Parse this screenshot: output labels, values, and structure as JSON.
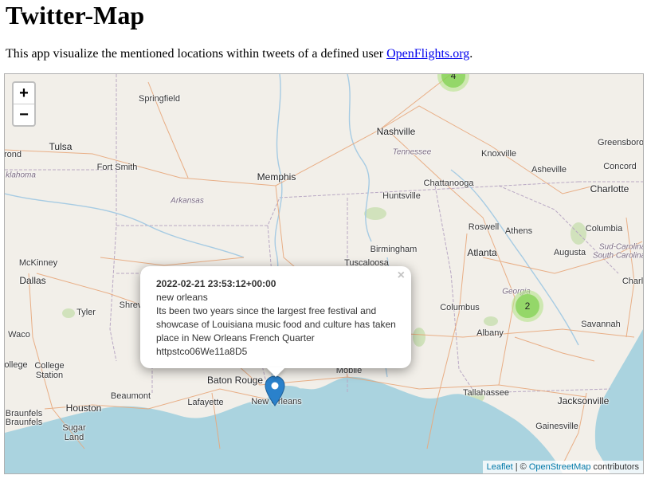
{
  "page": {
    "title": "Twitter-Map",
    "intro_text": "This app visualize the mentioned locations within tweets of a defined user ",
    "intro_link": "OpenFlights.org",
    "intro_end": "."
  },
  "map": {
    "zoom_in": "+",
    "zoom_out": "−",
    "cities": {
      "springfield": "Springfield",
      "nashville": "Nashville",
      "tennessee": "Tennessee",
      "greensboro": "Greensboro",
      "tulsa": "Tulsa",
      "knoxville": "Knoxville",
      "asheville": "Asheville",
      "concord": "Concord",
      "fort_smith": "Fort Smith",
      "memphis": "Memphis",
      "chattanooga": "Chattanooga",
      "charlotte": "Charlotte",
      "oklahoma": "klahoma",
      "arkansas": "Arkansas",
      "huntsville": "Huntsville",
      "rond": "rond",
      "roswell": "Roswell",
      "athens": "Athens",
      "columbia": "Columbia",
      "birmingham": "Birmingham",
      "atlanta": "Atlanta",
      "augusta": "Augusta",
      "sud_carolina": "Sud-Carolina",
      "south_carolina": "South Carolina",
      "mckinney": "McKinney",
      "tuscaloosa": "Tuscaloosa",
      "dallas": "Dallas",
      "shrev": "Shrev",
      "tyler": "Tyler",
      "columbus": "Columbus",
      "georgia": "Georgia",
      "charl": "Charl",
      "savannah": "Savannah",
      "waco": "Waco",
      "albany": "Albany",
      "college_station": "College\nStation",
      "baton_rouge": "Baton Rouge",
      "mobile": "Mobile",
      "tallahassee": "Tallahassee",
      "beaumont": "Beaumont",
      "lafayette": "Lafayette",
      "new_orleans": "New Orleans",
      "jacksonville": "Jacksonville",
      "houston": "Houston",
      "braunfels": "Braunfels",
      "braunfels2": "Braunfels",
      "sugar_land": "Sugar\nLand",
      "gainesville": "Gainesville",
      "colleg": "ollege"
    },
    "clusters": [
      {
        "count": "4",
        "color": "#6ecc39"
      },
      {
        "count": "2",
        "color": "#6ecc39"
      }
    ],
    "marker_color": "#2a81cb",
    "popup": {
      "date": "2022-02-21 23:53:12+00:00",
      "place": "new orleans",
      "text": "Its been two years since the largest free festival and showcase of Louisiana music food and culture has taken place in New Orleans French Quarter httpstco06We11a8D5",
      "close": "×"
    },
    "attribution": {
      "leaflet": "Leaflet",
      "sep": " | © ",
      "osm": "OpenStreetMap",
      "contributors": " contributors"
    }
  }
}
